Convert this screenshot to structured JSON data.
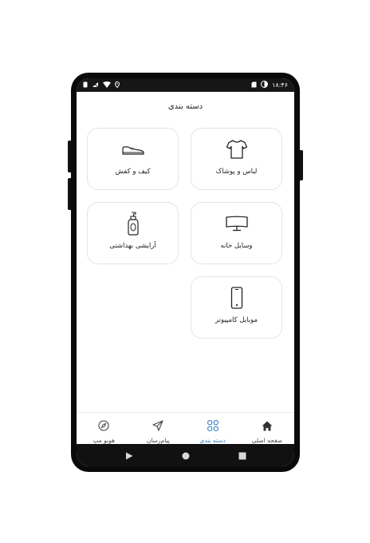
{
  "status_bar": {
    "time": "۱۸:۴۶",
    "left_icons": [
      "sim-card-icon",
      "data-saver-icon",
      "wifi-icon",
      "location-icon"
    ],
    "right_icons": [
      "sim-icon",
      "battery-icon"
    ]
  },
  "page": {
    "title": "دسته بندی"
  },
  "categories": [
    {
      "label": "لباس و پوشاک",
      "icon": "shirt-icon"
    },
    {
      "label": "کیف و کفش",
      "icon": "shoe-icon"
    },
    {
      "label": "وسایل خانه",
      "icon": "monitor-icon"
    },
    {
      "label": "آرایشی بهداشتی",
      "icon": "lotion-bottle-icon"
    },
    {
      "label": "موبایل کامپیوتر",
      "icon": "mobile-phone-icon"
    }
  ],
  "bottom_nav": [
    {
      "label": "صفحه اصلی",
      "icon": "home-icon",
      "active": false
    },
    {
      "label": "دسته بندی",
      "icon": "grid-icon",
      "active": true
    },
    {
      "label": "پیام‌رسان",
      "icon": "send-icon",
      "active": false
    },
    {
      "label": "هوبو مپ",
      "icon": "compass-icon",
      "active": false
    }
  ],
  "colors": {
    "accent": "#3b82c4",
    "frame": "#0a0a0a",
    "card_border": "#e4e4e4"
  }
}
